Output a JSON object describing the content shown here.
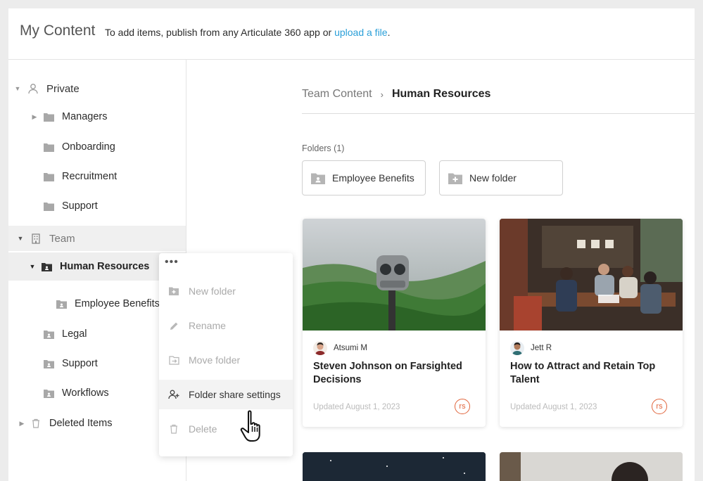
{
  "header": {
    "title": "My Content",
    "tagline_prefix": "To add items, publish from any Articulate 360 app or",
    "upload_link": "upload a file",
    "tagline_suffix": "."
  },
  "sidebar": {
    "private": {
      "label": "Private",
      "items": [
        {
          "label": "Managers"
        },
        {
          "label": "Onboarding"
        },
        {
          "label": "Recruitment"
        },
        {
          "label": "Support"
        }
      ]
    },
    "team": {
      "label": "Team",
      "items": [
        {
          "label": "Human Resources"
        },
        {
          "label": "Employee Benefits"
        },
        {
          "label": "Legal"
        },
        {
          "label": "Support"
        },
        {
          "label": "Workflows"
        }
      ]
    },
    "deleted": {
      "label": "Deleted Items"
    }
  },
  "context_menu": {
    "dots": "•••",
    "items": [
      {
        "label": "New folder",
        "icon": "new-folder-icon",
        "enabled": false
      },
      {
        "label": "Rename",
        "icon": "pencil-icon",
        "enabled": false
      },
      {
        "label": "Move folder",
        "icon": "move-folder-icon",
        "enabled": false
      },
      {
        "label": "Folder share settings",
        "icon": "share-user-icon",
        "enabled": true
      },
      {
        "label": "Delete",
        "icon": "trash-icon",
        "enabled": false
      }
    ]
  },
  "main": {
    "breadcrumb": {
      "root": "Team Content",
      "sep": "›",
      "current": "Human Resources"
    },
    "folders_label": "Folders (1)",
    "folders": [
      {
        "label": "Employee Benefits",
        "icon": "shared-folder-icon"
      },
      {
        "label": "New folder",
        "icon": "add-folder-icon"
      }
    ],
    "cards": [
      {
        "author": "Atsumi M",
        "title": "Steven Johnson on Farsighted Decisions",
        "updated": "Updated August 1, 2023",
        "badge": "rs"
      },
      {
        "author": "Jett R",
        "title": "How to Attract and Retain Top Talent",
        "updated": "Updated August 1, 2023",
        "badge": "rs"
      }
    ]
  },
  "colors": {
    "link": "#2a9fd8",
    "badge": "#e0633a",
    "selected_row": "#eeeeee"
  }
}
